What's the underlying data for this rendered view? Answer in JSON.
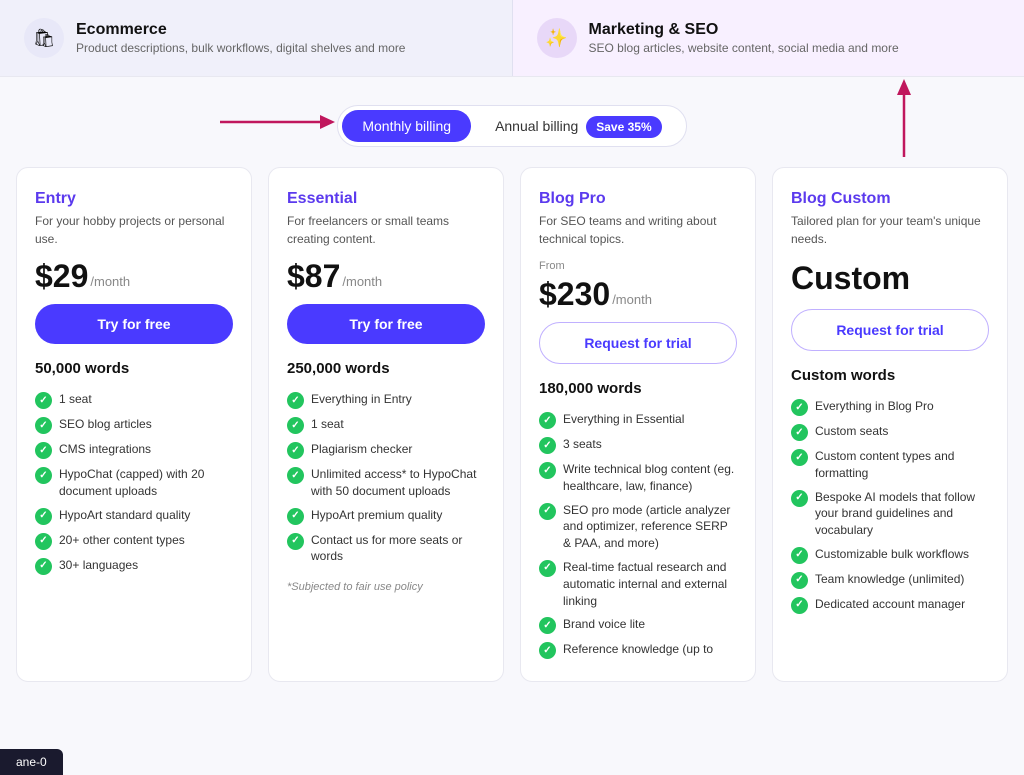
{
  "categories": [
    {
      "id": "ecommerce",
      "icon": "🛍",
      "title": "Ecommerce",
      "desc": "Product descriptions, bulk workflows, digital shelves and more"
    },
    {
      "id": "marketing",
      "icon": "✨",
      "title": "Marketing & SEO",
      "desc": "SEO blog articles, website content, social media and more"
    }
  ],
  "billing": {
    "monthly_label": "Monthly billing",
    "annual_label": "Annual billing",
    "save_badge": "Save 35%",
    "active": "monthly"
  },
  "plans": [
    {
      "id": "entry",
      "name": "Entry",
      "desc": "For your hobby projects or personal use.",
      "price": "$29",
      "period": "/month",
      "from": "",
      "custom": false,
      "btn_label": "Try for free",
      "btn_type": "primary",
      "words": "50,000 words",
      "features": [
        "1 seat",
        "SEO blog articles",
        "CMS integrations",
        "HypoChat (capped) with 20 document uploads",
        "HypoArt standard quality",
        "20+ other content types",
        "30+ languages"
      ],
      "note": ""
    },
    {
      "id": "essential",
      "name": "Essential",
      "desc": "For freelancers or small teams creating content.",
      "price": "$87",
      "period": "/month",
      "from": "",
      "custom": false,
      "btn_label": "Try for free",
      "btn_type": "primary",
      "words": "250,000 words",
      "features": [
        "Everything in Entry",
        "1 seat",
        "Plagiarism checker",
        "Unlimited access* to HypoChat with 50 document uploads",
        "HypoArt premium quality",
        "Contact us for more seats or words"
      ],
      "note": "*Subjected to fair use policy"
    },
    {
      "id": "blogpro",
      "name": "Blog Pro",
      "desc": "For SEO teams and writing about technical topics.",
      "price": "$230",
      "period": "/month",
      "from": "From",
      "custom": false,
      "btn_label": "Request for trial",
      "btn_type": "outline",
      "words": "180,000 words",
      "features": [
        "Everything in Essential",
        "3 seats",
        "Write technical blog content (eg. healthcare, law, finance)",
        "SEO pro mode (article analyzer and optimizer, reference SERP & PAA, and more)",
        "Real-time factual research and automatic internal and external linking",
        "Brand voice lite",
        "Reference knowledge (up to"
      ],
      "note": ""
    },
    {
      "id": "blogcustom",
      "name": "Blog Custom",
      "desc": "Tailored plan for your team's unique needs.",
      "price": "Custom",
      "period": "",
      "from": "",
      "custom": true,
      "btn_label": "Request for trial",
      "btn_type": "outline",
      "words": "Custom words",
      "features": [
        "Everything in Blog Pro",
        "Custom seats",
        "Custom content types and formatting",
        "Bespoke AI models that follow your brand guidelines and vocabulary",
        "Customizable bulk workflows",
        "Team knowledge (unlimited)",
        "Dedicated account manager"
      ],
      "note": ""
    }
  ],
  "bottom_tab": "ane-0"
}
